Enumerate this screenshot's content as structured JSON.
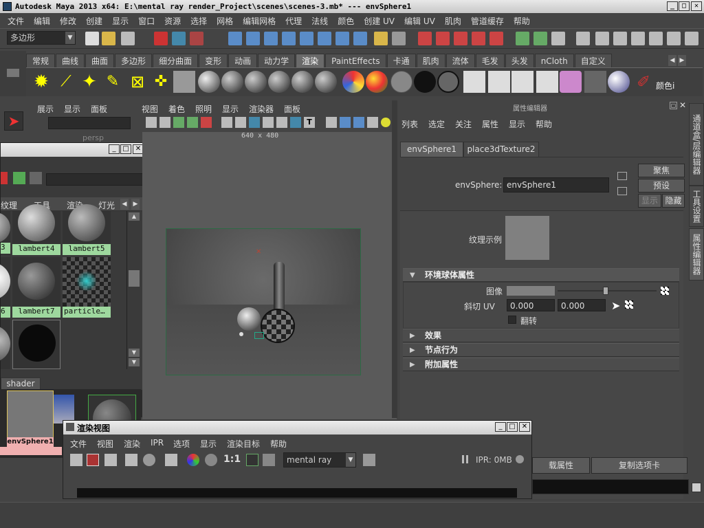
{
  "window": {
    "title": "Autodesk Maya 2013 x64: E:\\mental ray render_Project\\scenes\\scenes-3.mb*   ---   envSphere1"
  },
  "menubar": [
    "文件",
    "编辑",
    "修改",
    "创建",
    "显示",
    "窗口",
    "资源",
    "选择",
    "网格",
    "编辑网格",
    "代理",
    "法线",
    "颜色",
    "创建 UV",
    "编辑 UV",
    "肌肉",
    "管道缓存",
    "帮助"
  ],
  "statusline": {
    "mode_value": "多边形"
  },
  "shelf_tabs": [
    "常规",
    "曲线",
    "曲面",
    "多边形",
    "细分曲面",
    "变形",
    "动画",
    "动力学",
    "渲染",
    "PaintEffects",
    "卡通",
    "肌肉",
    "流体",
    "毛发",
    "头发",
    "nCloth",
    "自定义"
  ],
  "shelf_active": "渲染",
  "shelf_last_label": "颜色i",
  "outliner_menu": [
    "展示",
    "显示",
    "面板"
  ],
  "outliner_item": "persp",
  "hypershade": {
    "tabs": [
      "纹理",
      "工具",
      "渲染",
      "灯光"
    ],
    "swatches": [
      {
        "label": "3",
        "kind": "sphere"
      },
      {
        "label": "lambert4",
        "kind": "sphere"
      },
      {
        "label": "lambert5",
        "kind": "sphere"
      },
      {
        "label": "6",
        "kind": "sphere"
      },
      {
        "label": "lambert7",
        "kind": "sphere"
      },
      {
        "label": "particle…",
        "kind": "checker"
      }
    ],
    "shader_tab": "shader",
    "node_label": "envSphere1"
  },
  "viewport": {
    "menu": [
      "视图",
      "着色",
      "照明",
      "显示",
      "渲染器",
      "面板"
    ],
    "resolution": "640 x 480"
  },
  "attribute_editor": {
    "title": "属性编辑器",
    "menu": [
      "列表",
      "选定",
      "关注",
      "属性",
      "显示",
      "帮助"
    ],
    "tabs": [
      "envSphere1",
      "place3dTexture2"
    ],
    "node_type_label": "envSphere:",
    "node_name": "envSphere1",
    "buttons": {
      "focus": "聚焦",
      "presets": "预设",
      "show": "显示",
      "hide": "隐藏"
    },
    "texture_sample_label": "纹理示例",
    "section_env": "环境球体属性",
    "image_label": "图像",
    "shear_label": "斜切 UV",
    "shear_u": "0.000",
    "shear_v": "0.000",
    "flip_label": "翻转",
    "sections_collapsed": [
      "效果",
      "节点行为",
      "附加属性"
    ],
    "bottom_buttons": {
      "load": "载属性",
      "copy_tab": "复制选项卡"
    }
  },
  "side_tabs": [
    "通道盒/层编辑器",
    "工具设置",
    "属性编辑器"
  ],
  "render_view": {
    "title": "渲染视图",
    "menu": [
      "文件",
      "视图",
      "渲染",
      "IPR",
      "选项",
      "显示",
      "渲染目标",
      "帮助"
    ],
    "ratio": "1:1",
    "renderer": "mental ray",
    "ipr_status": "IPR: 0MB"
  }
}
